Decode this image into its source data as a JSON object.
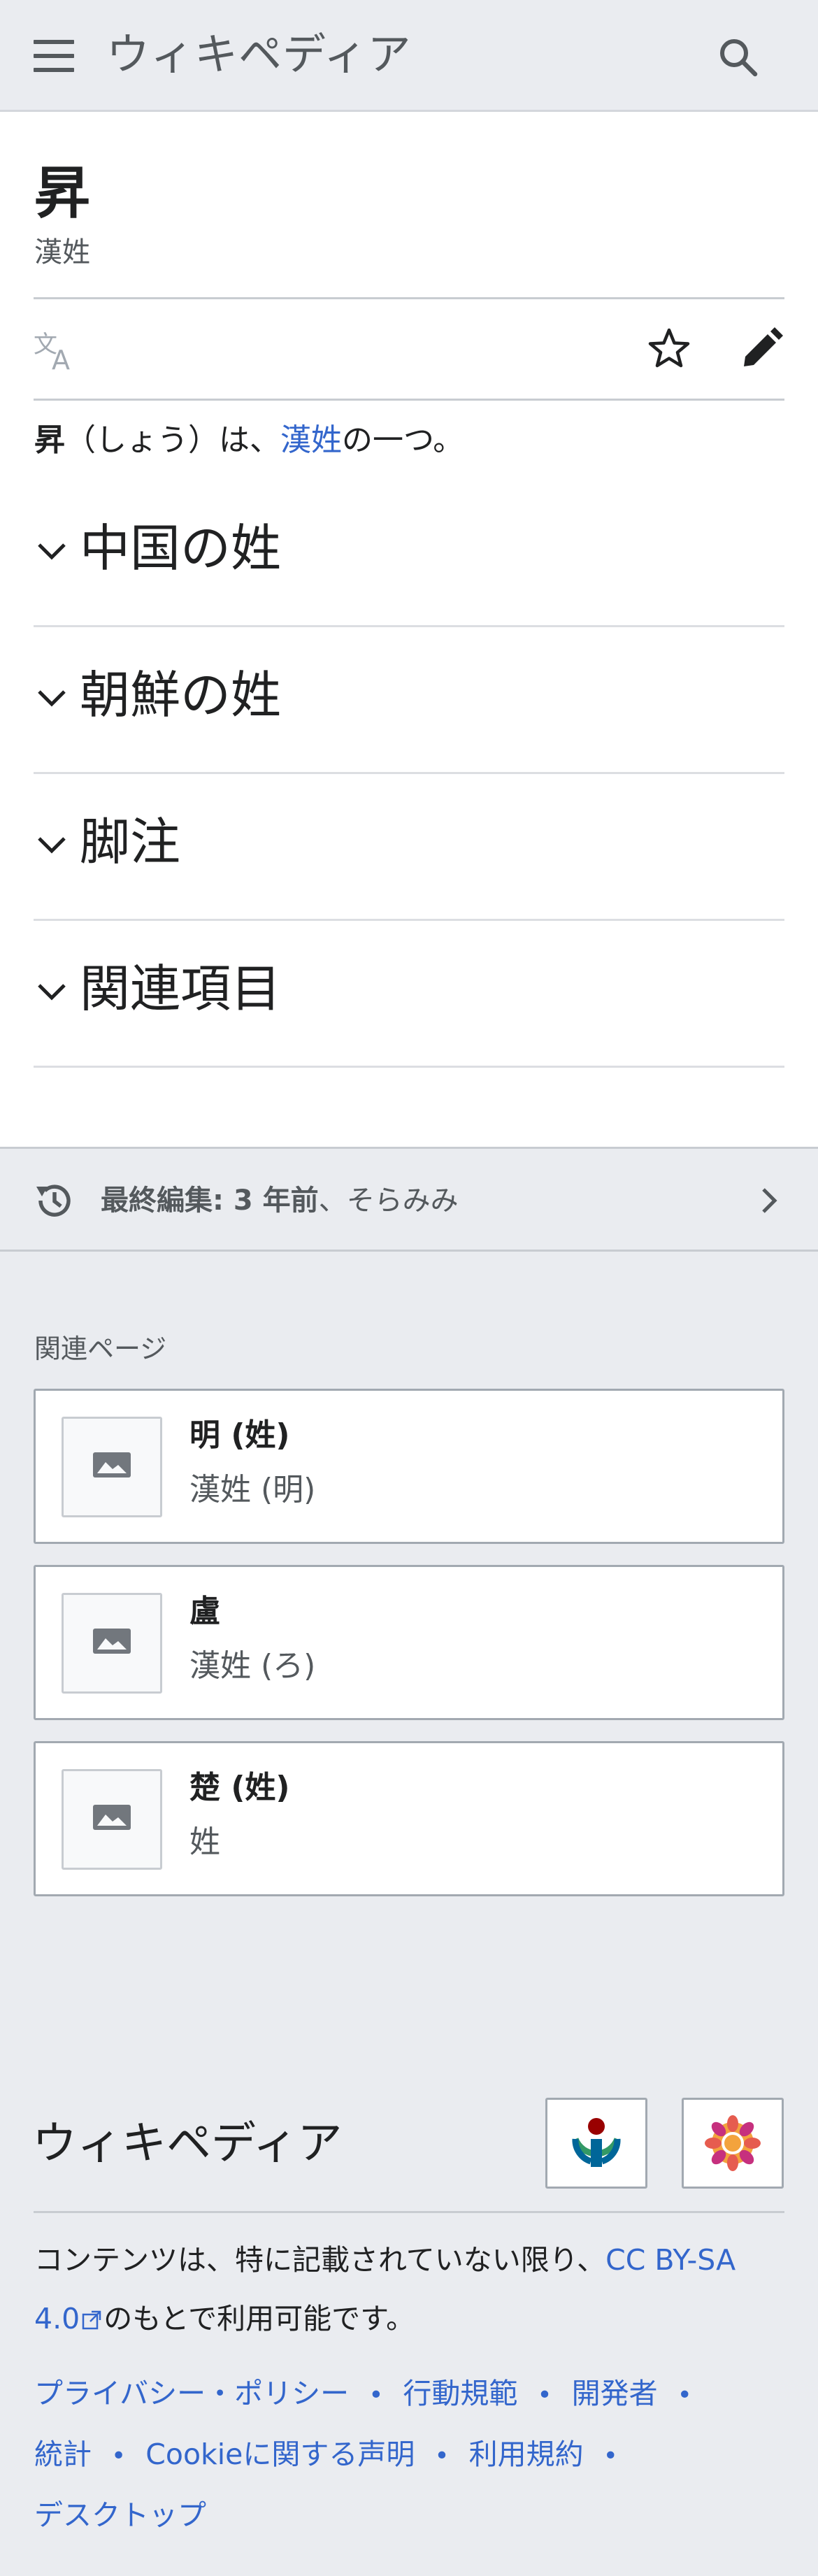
{
  "header": {
    "wordmark": "ウィキペディア",
    "menu_icon": "hamburger-menu-icon",
    "search_icon": "search-icon"
  },
  "article": {
    "title": "昇",
    "subtitle": "漢姓",
    "lead_bold": "昇",
    "lead_reading": "（しょう）は、",
    "lead_link": "漢姓",
    "lead_rest": "の一つ。",
    "sections": [
      "中国の姓",
      "朝鮮の姓",
      "脚注",
      "関連項目"
    ]
  },
  "last_edited": {
    "label": "最終編集: 3 年前",
    "separator": "、",
    "user": "そらみみ"
  },
  "related": {
    "label": "関連ページ",
    "items": [
      {
        "title": "明 (姓)",
        "description": "漢姓 (明)"
      },
      {
        "title": "盧",
        "description": "漢姓 (ろ)"
      },
      {
        "title": "楚 (姓)",
        "description": "姓"
      }
    ]
  },
  "footer": {
    "wordmark": "ウィキペディア",
    "license_prefix": "コンテンツは、特に記載されていない限り、",
    "license_link": "CC BY-SA 4.0",
    "license_suffix": "のもとで利用可能です。",
    "links": [
      "プライバシー・ポリシー",
      "行動規範",
      "開発者",
      "統計",
      "Cookieに関する声明",
      "利用規約",
      "デスクトップ"
    ]
  },
  "colors": {
    "link": "#3366cc",
    "chrome_bg": "#eaecf0",
    "text": "#202122",
    "muted": "#54595d"
  }
}
